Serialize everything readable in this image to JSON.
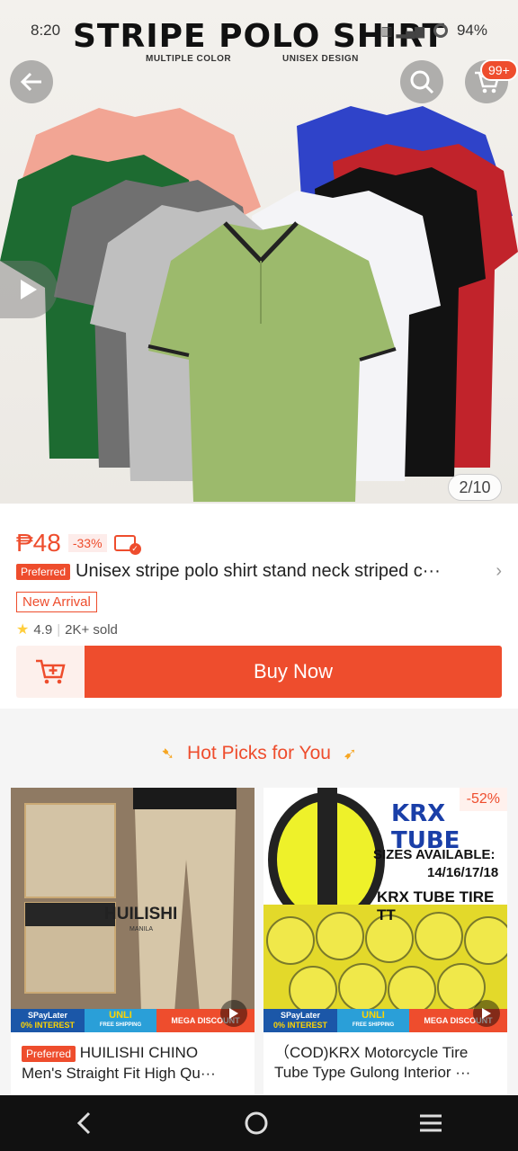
{
  "status_bar": {
    "time": "8:20",
    "battery": "94%"
  },
  "hero": {
    "title": "STRIPE POLO SHIRT",
    "sub_left": "MULTIPLE COLOR",
    "sub_right": "UNISEX DESIGN",
    "cart_badge": "99+",
    "counter": "2/10"
  },
  "product": {
    "price": "₱48",
    "discount": "-33%",
    "preferred_label": "Preferred",
    "title": "Unisex stripe polo shirt stand neck striped c···",
    "new_arrival": "New Arrival",
    "rating": "4.9",
    "sold": "2K+ sold",
    "buy_now": "Buy Now"
  },
  "hot_picks": {
    "heading": "Hot Picks for You",
    "items": [
      {
        "preferred_label": "Preferred",
        "line1": "HUILISHI  CHINO",
        "line2": "Men's Straight Fit High Qu···",
        "brand_watermark": "HUILISHI",
        "brand_sub": "MANILA"
      },
      {
        "line1": "（COD)KRX Motorcycle Tire",
        "line2": "Tube Type Gulong Interior ···",
        "discount": "-52%",
        "img_title": "KRX TUBE",
        "img_sizes_label": "SIZES AVAILABLE:",
        "img_sizes": "14/16/17/18",
        "img_footer": "KRX TUBE TIRE TT"
      }
    ],
    "promo": {
      "spaylater": "SPayLater",
      "interest": "0% INTEREST",
      "unli": "UNLI",
      "free_ship": "FREE SHIPPING",
      "mega": "MEGA DISCOUNT"
    }
  },
  "colors": {
    "accent": "#ee4d2d"
  }
}
